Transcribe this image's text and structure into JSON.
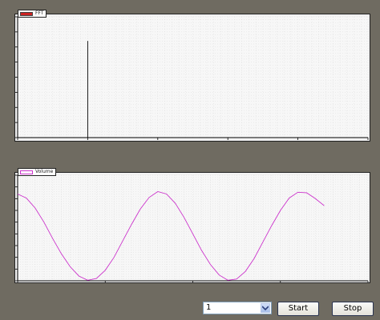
{
  "colors": {
    "background": "#6f6b61",
    "fft_series": "#000000",
    "fft_legend_swatch": "#cc2222",
    "volume_series": "#cc33cc"
  },
  "chart_data": [
    {
      "type": "line",
      "title": "",
      "xlabel": "",
      "ylabel": "",
      "xlim": [
        -5,
        20
      ],
      "ylim": [
        0,
        800
      ],
      "x_ticks": [
        -5,
        0,
        5,
        10,
        15,
        20
      ],
      "y_ticks": [
        0,
        100,
        200,
        300,
        400,
        500,
        600,
        700,
        800
      ],
      "grid": true,
      "legend": "top-left",
      "series": [
        {
          "name": "FFT",
          "x": [
            0,
            0
          ],
          "y": [
            0,
            640
          ]
        }
      ]
    },
    {
      "type": "line",
      "title": "",
      "xlabel": "",
      "ylabel": "",
      "xlim": [
        0,
        40
      ],
      "ylim": [
        0,
        900
      ],
      "x_ticks": [
        0,
        10,
        20,
        30,
        40
      ],
      "y_ticks": [
        0,
        100,
        200,
        300,
        400,
        500,
        600,
        700,
        800,
        900
      ],
      "grid": true,
      "legend": "top-left",
      "series": [
        {
          "name": "Volume",
          "x": [
            0,
            1,
            2,
            3,
            4,
            5,
            6,
            7,
            8,
            9,
            10,
            11,
            12,
            13,
            14,
            15,
            16,
            17,
            18,
            19,
            20,
            21,
            22,
            23,
            24,
            25,
            26,
            27,
            28,
            29,
            30,
            31,
            32,
            33,
            34,
            35
          ],
          "y": [
            740,
            705,
            620,
            500,
            360,
            230,
            120,
            40,
            5,
            20,
            90,
            200,
            340,
            480,
            610,
            710,
            760,
            740,
            660,
            540,
            400,
            260,
            140,
            50,
            5,
            15,
            80,
            190,
            330,
            470,
            600,
            705,
            755,
            750,
            700,
            640
          ]
        }
      ]
    }
  ],
  "controls": {
    "select_value": "1",
    "start_label": "Start",
    "stop_label": "Stop"
  }
}
